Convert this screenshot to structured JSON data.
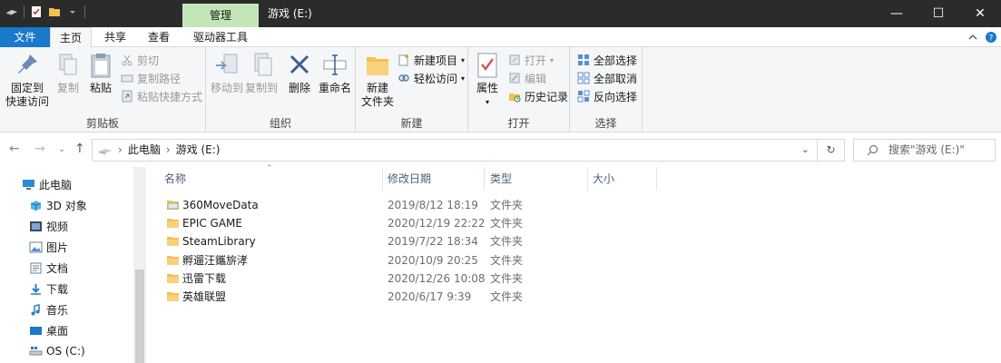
{
  "window": {
    "context_tab": "管理",
    "title": "游戏 (E:)",
    "minimize": "—",
    "maximize": "☐",
    "close": "✕"
  },
  "tabs": [
    "文件",
    "主页",
    "共享",
    "查看",
    "驱动器工具"
  ],
  "ribbon": {
    "clipboard": {
      "label": "剪贴板",
      "pin": "固定到",
      "pin2": "快速访问",
      "copy": "复制",
      "paste": "粘贴",
      "cut": "剪切",
      "copy_path": "复制路径",
      "paste_shortcut": "粘贴快捷方式"
    },
    "organize": {
      "label": "组织",
      "move_to": "移动到",
      "copy_to": "复制到",
      "delete": "删除",
      "rename": "重命名"
    },
    "new": {
      "label": "新建",
      "new_folder": "新建",
      "new_folder2": "文件夹",
      "new_item": "新建项目",
      "easy_access": "轻松访问"
    },
    "open": {
      "label": "打开",
      "properties": "属性",
      "open": "打开",
      "edit": "编辑",
      "history": "历史记录"
    },
    "select": {
      "label": "选择",
      "select_all": "全部选择",
      "select_none": "全部取消",
      "invert": "反向选择"
    }
  },
  "address": {
    "crumbs": [
      "此电脑",
      "游戏 (E:)"
    ],
    "search_placeholder": "搜索\"游戏 (E:)\""
  },
  "navpane": {
    "items": [
      "此电脑",
      "3D 对象",
      "视频",
      "图片",
      "文档",
      "下载",
      "音乐",
      "桌面",
      "OS (C:)"
    ]
  },
  "columns": [
    "名称",
    "修改日期",
    "类型",
    "大小"
  ],
  "files": [
    {
      "name": "360MoveData",
      "date": "2019/8/12 18:19",
      "type": "文件夹"
    },
    {
      "name": "EPIC GAME",
      "date": "2020/12/19 22:22",
      "type": "文件夹"
    },
    {
      "name": "SteamLibrary",
      "date": "2019/7/22 18:34",
      "type": "文件夹"
    },
    {
      "name": "孵遛汪鑴旂涍",
      "date": "2020/10/9 20:25",
      "type": "文件夹"
    },
    {
      "name": "迅雷下载",
      "date": "2020/12/26 10:08",
      "type": "文件夹"
    },
    {
      "name": "英雄联盟",
      "date": "2020/6/17 9:39",
      "type": "文件夹"
    }
  ],
  "colors": {
    "accent": "#1979ca",
    "context_tab": "#c3e6b8",
    "titlebar": "#2b2b2b",
    "folder": "#f3c14e"
  }
}
